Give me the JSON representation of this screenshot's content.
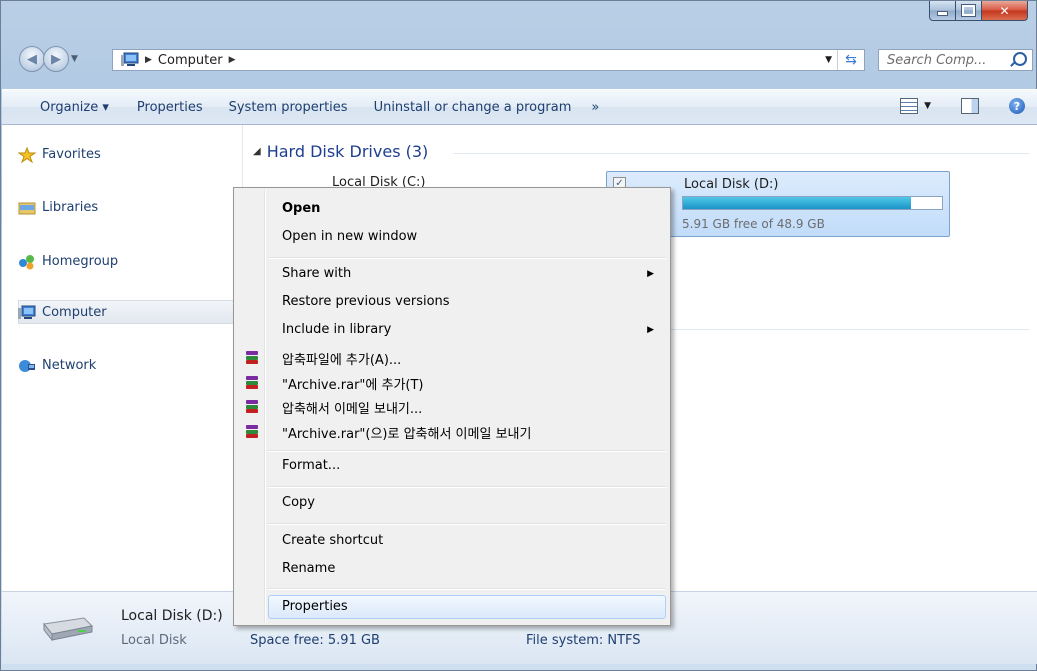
{
  "window": {
    "min_icon": "minimize-icon",
    "max_icon": "maximize-icon",
    "close_icon": "close-icon"
  },
  "address": {
    "computer_icon": "computer-icon",
    "crumb": "Computer",
    "search_placeholder": "Search Comp..."
  },
  "toolbar": {
    "organize": "Organize ▾",
    "properties": "Properties",
    "system_properties": "System properties",
    "uninstall": "Uninstall or change a program",
    "more": "»"
  },
  "nav": {
    "favorites": "Favorites",
    "libraries": "Libraries",
    "homegroup": "Homegroup",
    "computer": "Computer",
    "network": "Network"
  },
  "content": {
    "group_title": "Hard Disk Drives (3)",
    "drive_c": "Local Disk (C:)",
    "drive_d": {
      "name": "Local Disk (D:)",
      "free_text": "5.91 GB free of 48.9 GB",
      "used_fraction": 0.879
    }
  },
  "menu": {
    "open": "Open",
    "open_new": "Open in new window",
    "share": "Share with",
    "restore": "Restore previous versions",
    "include": "Include in library",
    "rar1": "압축파일에 추가(A)...",
    "rar2": "\"Archive.rar\"에 추가(T)",
    "rar3": "압축해서 이메일 보내기...",
    "rar4": "\"Archive.rar\"(으)로 압축해서 이메일 보내기",
    "format": "Format...",
    "copy": "Copy",
    "shortcut": "Create shortcut",
    "rename": "Rename",
    "properties": "Properties"
  },
  "status": {
    "name": "Local Disk (D:)",
    "type": "Local Disk",
    "space_free": "Space free: 5.91 GB",
    "file_system": "File system: NTFS"
  }
}
